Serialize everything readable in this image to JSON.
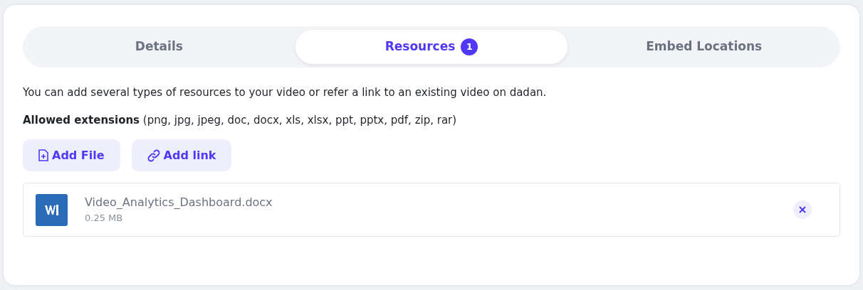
{
  "tabs": [
    {
      "label": "Details",
      "selected": false
    },
    {
      "label": "Resources",
      "selected": true,
      "badge": "1"
    },
    {
      "label": "Embed Locations",
      "selected": false
    }
  ],
  "description": "You can add several types of resources to your video or refer a link to an existing video on dadan.",
  "allowed_extensions": "**Allowed extensions** (png, jpg, jpeg, doc, docx, xls, xlsx, ppt, pptx, pdf, zip, rar)",
  "buttons": [
    {
      "label": "Add File",
      "kind": "file"
    },
    {
      "label": "Add link",
      "kind": "link"
    }
  ],
  "files": [
    {
      "name": "Video_Analytics_Dashboard.docx",
      "size": "0.25 MB",
      "kind": "word"
    }
  ]
}
